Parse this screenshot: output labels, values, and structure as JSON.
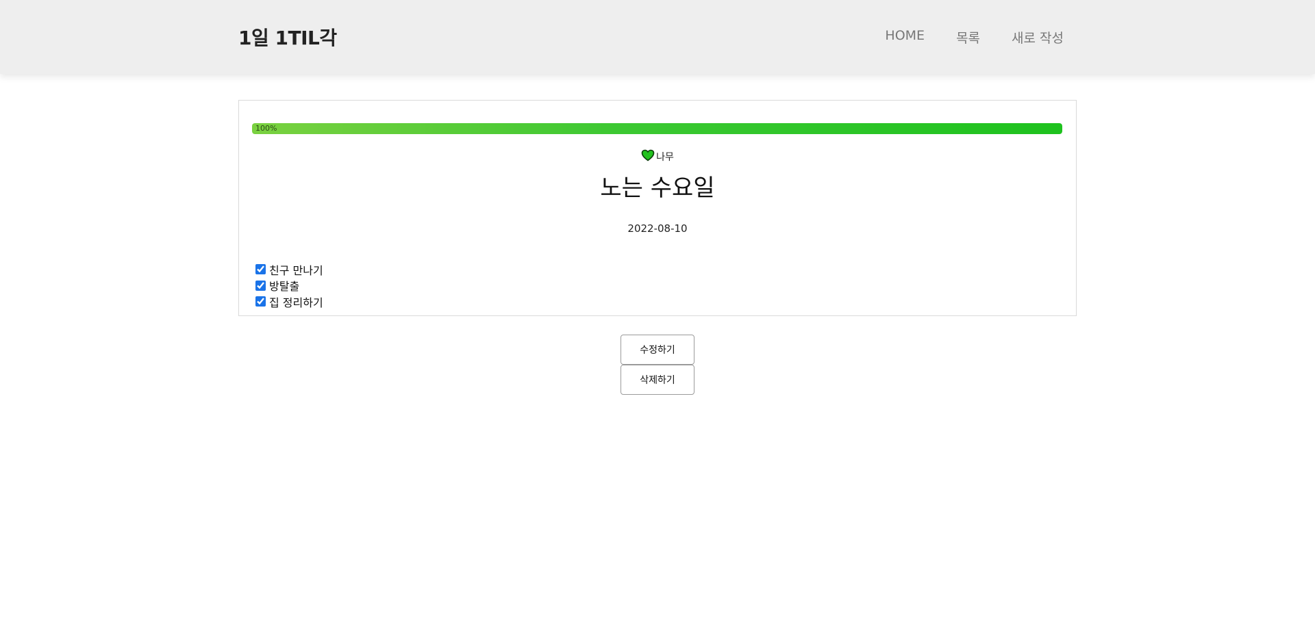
{
  "header": {
    "brand": "1일 1TIL각",
    "nav": [
      "HOME",
      "목록",
      "새로 작성"
    ]
  },
  "post": {
    "progress_label": "100%",
    "progress_value": 1.0,
    "author": "나무",
    "title": "노는 수요일",
    "date": "2022-08-10",
    "todos": [
      {
        "label": "친구 만나기",
        "checked": true
      },
      {
        "label": "방탈출",
        "checked": true
      },
      {
        "label": "집 정리하기",
        "checked": true
      }
    ]
  },
  "actions": {
    "edit_label": "수정하기",
    "delete_label": "삭제하기"
  },
  "colors": {
    "header_bg": "#eeeeee",
    "progress_start": "#7ad140",
    "progress_end": "#1ec21e",
    "heart": "#22c21e"
  },
  "icons": {
    "author": "heart-icon"
  }
}
